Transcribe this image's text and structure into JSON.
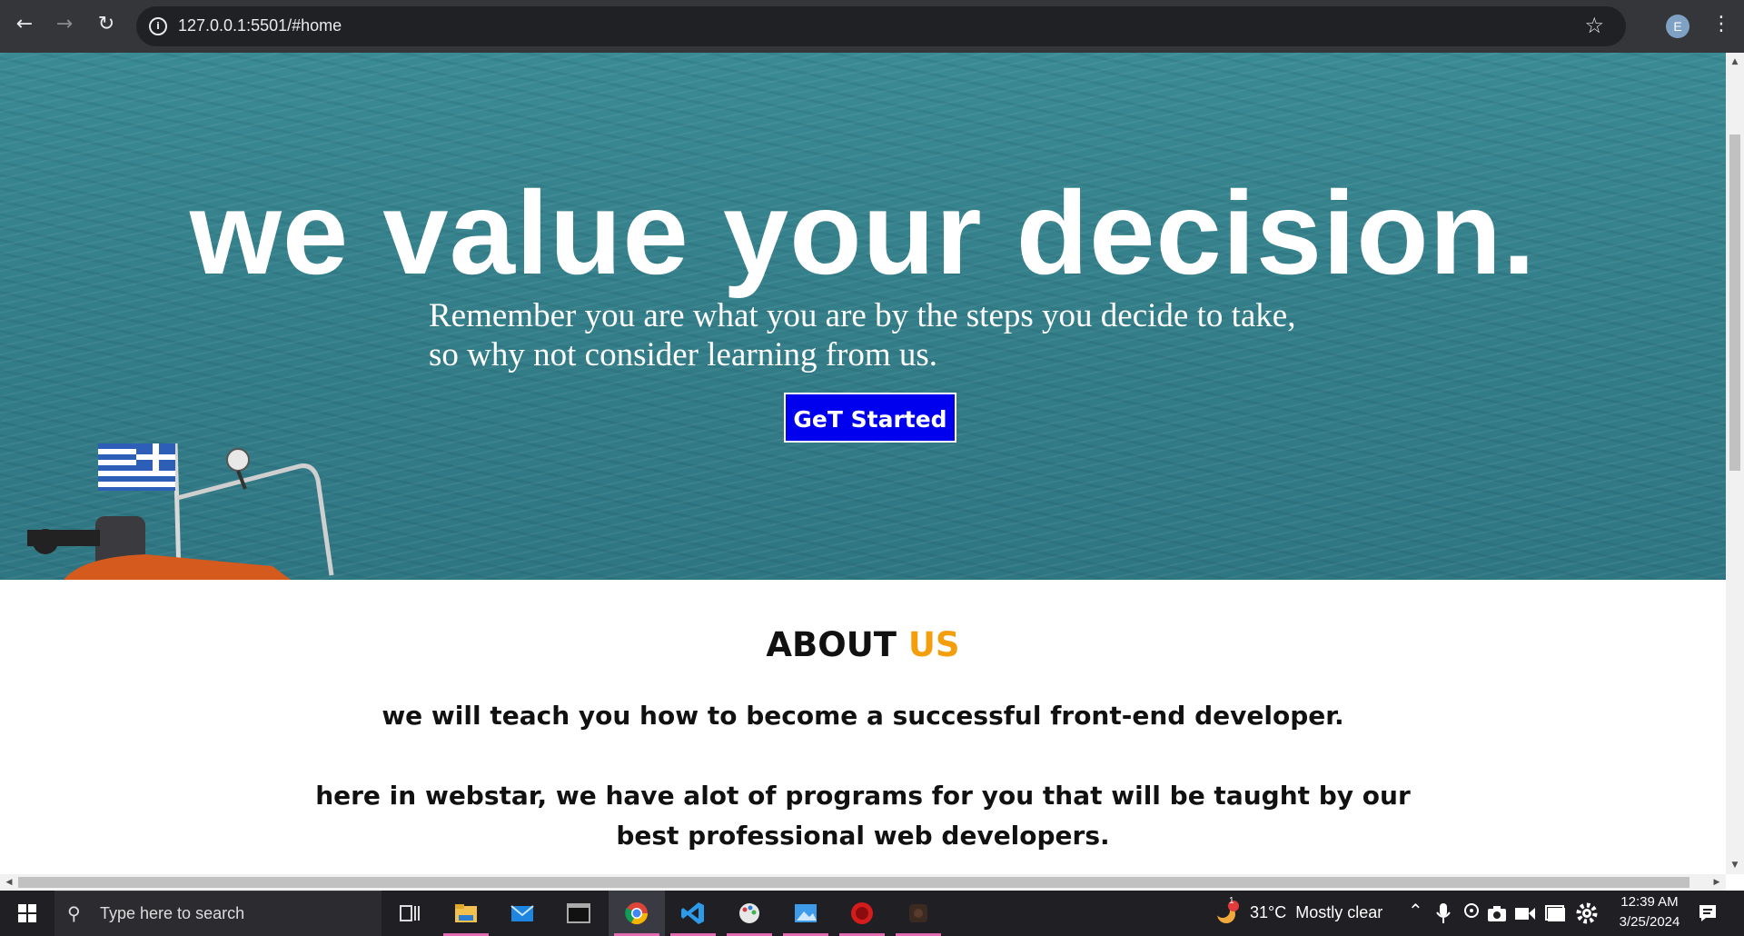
{
  "browser": {
    "url": "127.0.0.1:5501/#home",
    "profile_initial": "E"
  },
  "hero": {
    "title": "we value your decision.",
    "subtitle_line1": "Remember you are what you are by the steps you decide to take,",
    "subtitle_line2": "so why not consider learning from us.",
    "cta_label": "GeT Started"
  },
  "about": {
    "title_part1": "ABOUT",
    "title_part2": "US",
    "line1": "we will teach you how to become a successful front-end developer.",
    "line2": "here in webstar, we have alot of programs for you that will be taught by our",
    "line3": "best professional web developers."
  },
  "taskbar": {
    "search_placeholder": "Type here to search",
    "weather": "31°C  Mostly clear",
    "weather_badge": "1",
    "time": "12:39 AM",
    "date": "3/25/2024",
    "apps": [
      "task-view",
      "file-explorer",
      "mail",
      "terminal",
      "chrome",
      "vscode",
      "paint",
      "photos",
      "recorder",
      "obs"
    ]
  },
  "colors": {
    "accent_orange": "#f59e0b",
    "cta_blue": "#0000ee",
    "sea": "#347f8a"
  }
}
